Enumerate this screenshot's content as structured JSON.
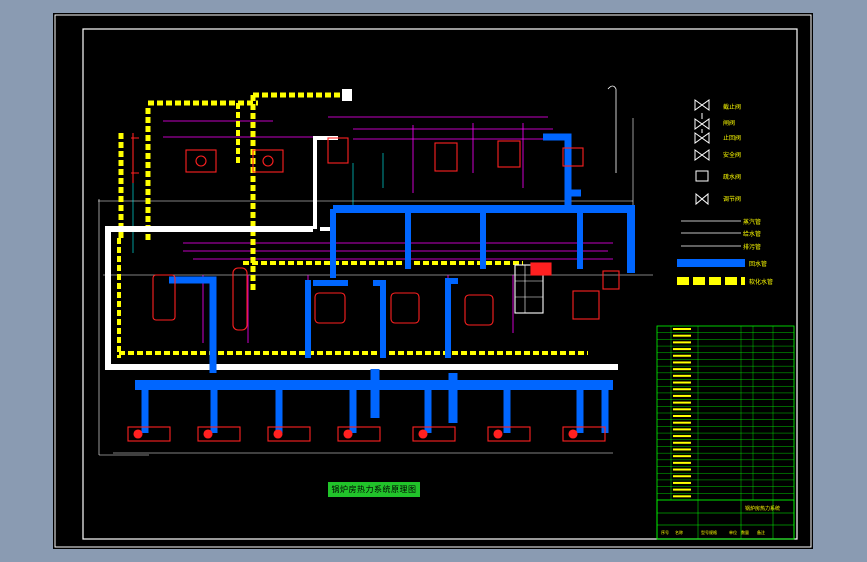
{
  "drawing": {
    "title": "锅炉房热力系统原理图",
    "legend_valves": [
      "截止阀",
      "闸阀",
      "止回阀",
      "安全阀",
      "疏水阀",
      "调节阀"
    ],
    "legend_pipes": [
      "蒸汽管",
      "给水管",
      "排污管",
      "回水管",
      "软化水管"
    ],
    "colors": {
      "background": "#000000",
      "frame": "#ffffff",
      "steam_pipe": "#0066ff",
      "water_pipe": "#ffff00",
      "return_pipe": "#ffffff",
      "equipment": "#ff2020",
      "thin_line": "#ff00ff",
      "table_line": "#00ff00"
    },
    "equipment_table": {
      "columns": [
        "序号",
        "名称",
        "型号规格",
        "单位",
        "数量",
        "备注"
      ],
      "rows": 26
    },
    "title_block": {
      "label": "锅炉房热力系统"
    }
  }
}
